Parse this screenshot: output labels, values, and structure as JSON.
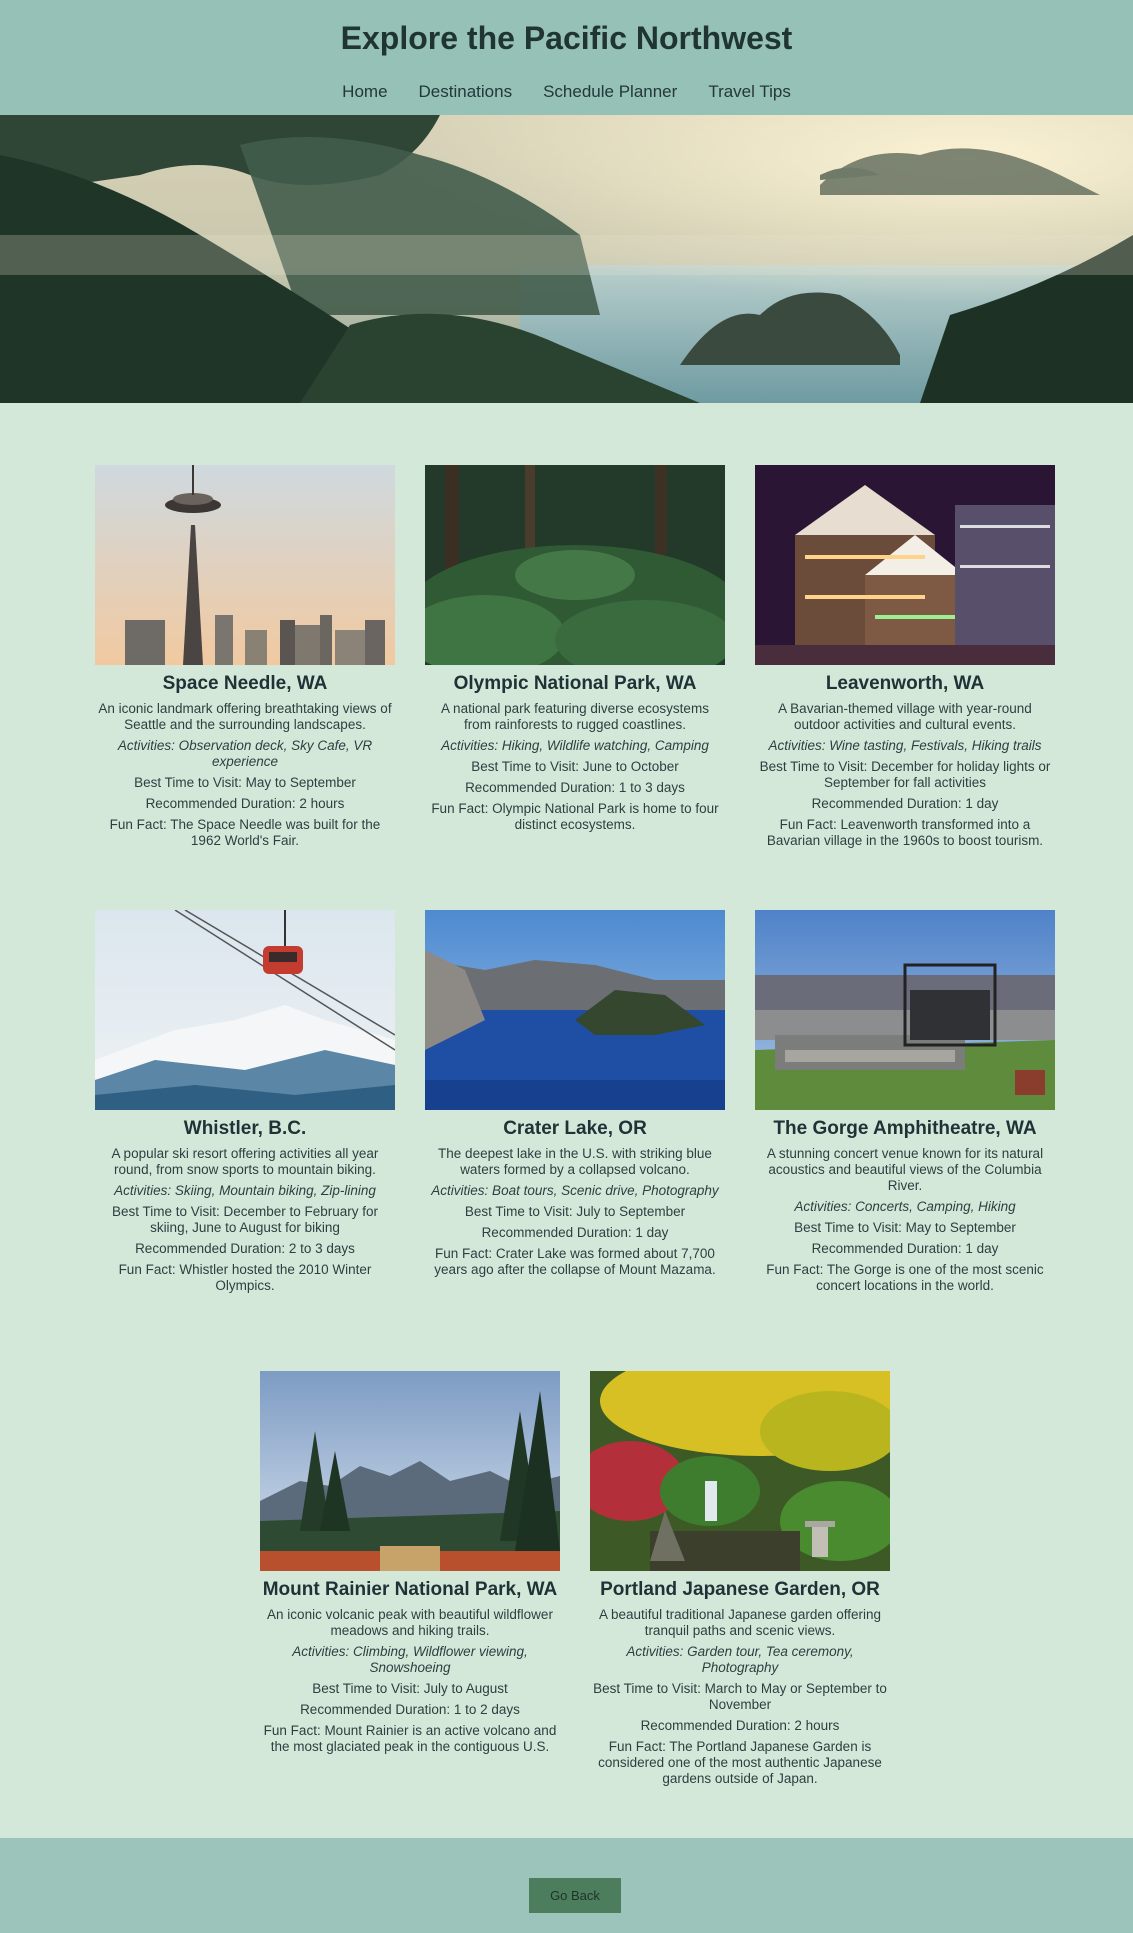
{
  "header": {
    "title": "Explore the Pacific Northwest",
    "nav": [
      "Home",
      "Destinations",
      "Schedule Planner",
      "Travel Tips"
    ]
  },
  "destinations": [
    {
      "name": "Space Needle, WA",
      "description": "An iconic landmark offering breathtaking views of Seattle and the surrounding landscapes.",
      "activities": "Activities: Observation deck, Sky Cafe, VR experience",
      "best_time": "Best Time to Visit: May to September",
      "duration": "Recommended Duration: 2 hours",
      "fun_fact": "Fun Fact: The Space Needle was built for the 1962 World's Fair."
    },
    {
      "name": "Olympic National Park, WA",
      "description": "A national park featuring diverse ecosystems from rainforests to rugged coastlines.",
      "activities": "Activities: Hiking, Wildlife watching, Camping",
      "best_time": "Best Time to Visit: June to October",
      "duration": "Recommended Duration: 1 to 3 days",
      "fun_fact": "Fun Fact: Olympic National Park is home to four distinct ecosystems."
    },
    {
      "name": "Leavenworth, WA",
      "description": "A Bavarian-themed village with year-round outdoor activities and cultural events.",
      "activities": "Activities: Wine tasting, Festivals, Hiking trails",
      "best_time": "Best Time to Visit: December for holiday lights or September for fall activities",
      "duration": "Recommended Duration: 1 day",
      "fun_fact": "Fun Fact: Leavenworth transformed into a Bavarian village in the 1960s to boost tourism."
    },
    {
      "name": "Whistler, B.C.",
      "description": "A popular ski resort offering activities all year round, from snow sports to mountain biking.",
      "activities": "Activities: Skiing, Mountain biking, Zip-lining",
      "best_time": "Best Time to Visit: December to February for skiing, June to August for biking",
      "duration": "Recommended Duration: 2 to 3 days",
      "fun_fact": "Fun Fact: Whistler hosted the 2010 Winter Olympics."
    },
    {
      "name": "Crater Lake, OR",
      "description": "The deepest lake in the U.S. with striking blue waters formed by a collapsed volcano.",
      "activities": "Activities: Boat tours, Scenic drive, Photography",
      "best_time": "Best Time to Visit: July to September",
      "duration": "Recommended Duration: 1 day",
      "fun_fact": "Fun Fact: Crater Lake was formed about 7,700 years ago after the collapse of Mount Mazama."
    },
    {
      "name": "The Gorge Amphitheatre, WA",
      "description": "A stunning concert venue known for its natural acoustics and beautiful views of the Columbia River.",
      "activities": "Activities: Concerts, Camping, Hiking",
      "best_time": "Best Time to Visit: May to September",
      "duration": "Recommended Duration: 1 day",
      "fun_fact": "Fun Fact: The Gorge is one of the most scenic concert locations in the world."
    },
    {
      "name": "Mount Rainier National Park, WA",
      "description": "An iconic volcanic peak with beautiful wildflower meadows and hiking trails.",
      "activities": "Activities: Climbing, Wildflower viewing, Snowshoeing",
      "best_time": "Best Time to Visit: July to August",
      "duration": "Recommended Duration: 1 to 2 days",
      "fun_fact": "Fun Fact: Mount Rainier is an active volcano and the most glaciated peak in the contiguous U.S."
    },
    {
      "name": "Portland Japanese Garden, OR",
      "description": "A beautiful traditional Japanese garden offering tranquil paths and scenic views.",
      "activities": "Activities: Garden tour, Tea ceremony, Photography",
      "best_time": "Best Time to Visit: March to May or September to November",
      "duration": "Recommended Duration: 2 hours",
      "fun_fact": "Fun Fact: The Portland Japanese Garden is considered one of the most authentic Japanese gardens outside of Japan."
    }
  ],
  "footer": {
    "go_back_label": "Go Back"
  }
}
